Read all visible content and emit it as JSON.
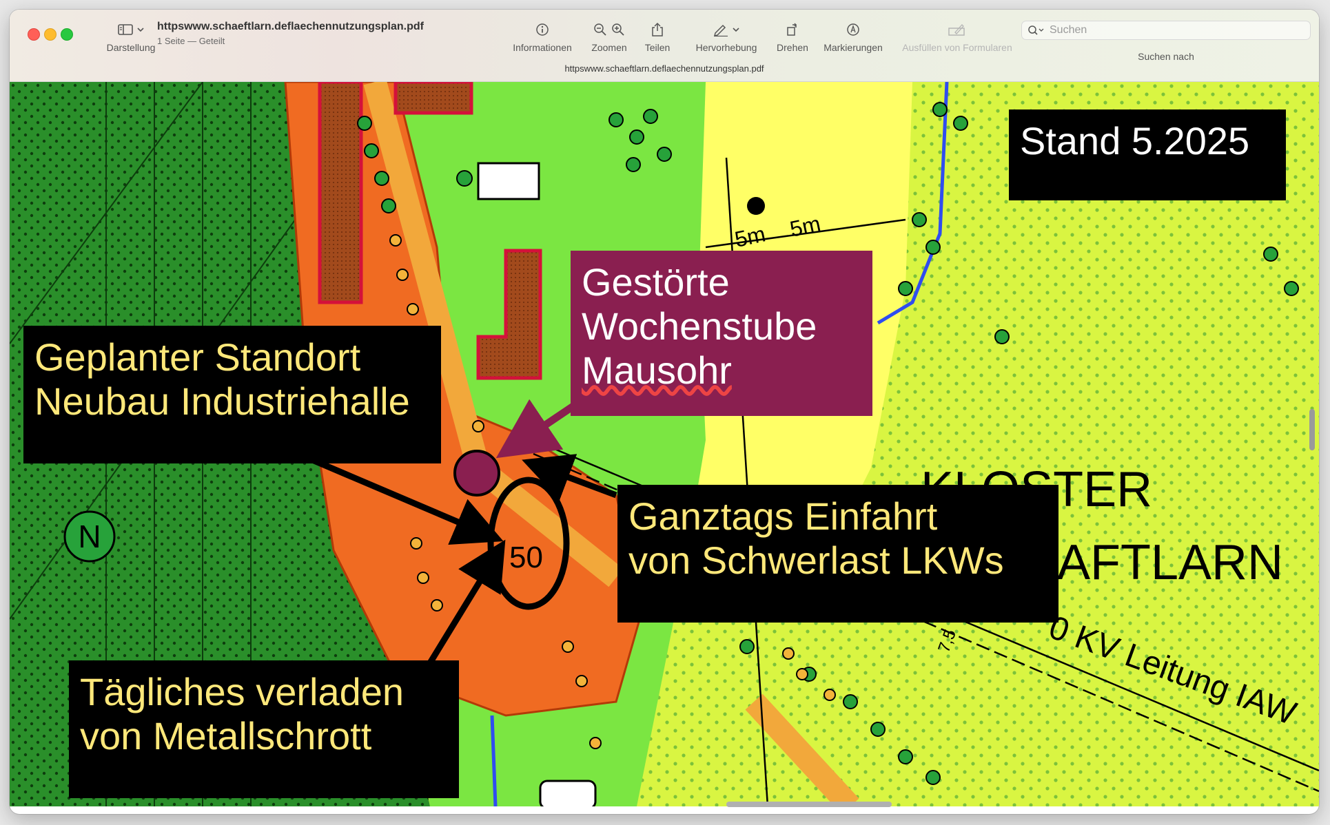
{
  "toolbar": {
    "view_label": "Darstellung",
    "doc_title": "httpswww.schaeftlarn.deflaechennutzungsplan.pdf",
    "doc_subtitle": "1 Seite — Geteilt",
    "doc_center_title": "httpswww.schaeftlarn.deflaechennutzungsplan.pdf",
    "info_label": "Informationen",
    "zoom_label": "Zoomen",
    "share_label": "Teilen",
    "highlight_label": "Hervorhebung",
    "rotate_label": "Drehen",
    "markup_label": "Markierungen",
    "forms_label": "Ausfüllen von Formularen",
    "search_placeholder": "Suchen",
    "search_label": "Suchen nach"
  },
  "colors": {
    "forest": "#1f7a1f",
    "green": "#7be642",
    "yellow": "#ffff66",
    "orange": "#f06b22",
    "lime_dots": "#d6f542",
    "annotation_purple": "#8a1f50"
  },
  "map": {
    "stand_label": "Stand 5.2025",
    "north_letter": "N",
    "label_5m_a": "5m",
    "label_5m_b": "5m",
    "kloster_line1": "KLOSTER",
    "kloster_line2": "AFTLARN",
    "leitung": "0 KV Leitung IAW",
    "small_75": "7,5",
    "small_50": "50",
    "annotations": {
      "gestoerte_line1": "Gestörte",
      "gestoerte_line2": "Wochenstube",
      "gestoerte_line3": "Mausohr",
      "standort_line1": "Geplanter Standort",
      "standort_line2": "Neubau Industriehalle",
      "einfahrt_line1": "Ganztags Einfahrt",
      "einfahrt_line2": "von Schwerlast LKWs",
      "verladen_line1": "Tägliches verladen",
      "verladen_line2": "von Metallschrott"
    }
  }
}
